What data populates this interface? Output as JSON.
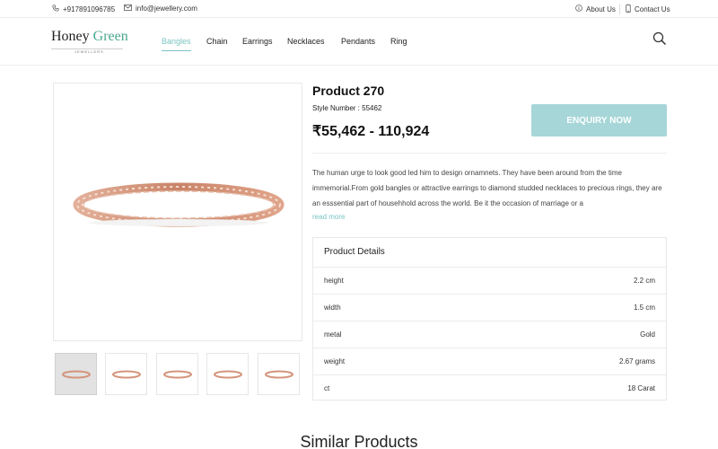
{
  "topbar": {
    "phone": "+917891096785",
    "email": "info@jewellery.com",
    "about": "About Us",
    "contact": "Contact Us"
  },
  "logo": {
    "word1": "Honey",
    "word2": "Green",
    "sub": "JEWELLERS"
  },
  "nav": {
    "items": [
      "Bangles",
      "Chain",
      "Earrings",
      "Necklaces",
      "Pendants",
      "Ring"
    ],
    "active": "Bangles"
  },
  "product": {
    "title": "Product 270",
    "style_number": "Style Number : 55462",
    "price": "₹55,462 - 110,924",
    "enquiry_label": "ENQUIRY NOW",
    "description": "The human urge to look good led him to design ornamnets. They have been around from the time immemorial.From gold bangles or attractive earrings to diamond studded necklaces to precious rings, they are an esssential part of househhold across the world. Be it the occasion of marriage or a",
    "read_more": "read more"
  },
  "details": {
    "heading": "Product Details",
    "rows": [
      {
        "label": "height",
        "value": "2.2 cm"
      },
      {
        "label": "width",
        "value": "1.5 cm"
      },
      {
        "label": "metal",
        "value": "Gold"
      },
      {
        "label": "weight",
        "value": "2.67 grams"
      },
      {
        "label": "ct",
        "value": "18 Carat"
      }
    ]
  },
  "similar_heading": "Similar Products",
  "colors": {
    "accent": "#7ac4c2",
    "button": "#a7d6d8",
    "bangle": "#d79a80"
  },
  "icons": [
    "phone-icon",
    "mail-icon",
    "info-icon",
    "mobile-icon",
    "search-icon"
  ]
}
